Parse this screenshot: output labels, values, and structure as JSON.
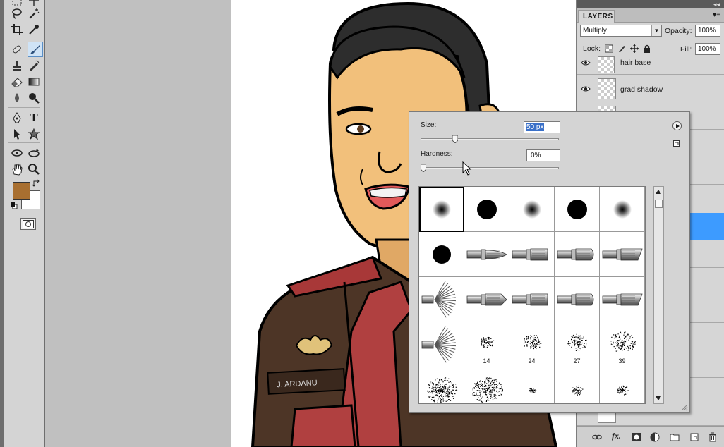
{
  "colors": {
    "foreground": "#a86f30",
    "background": "#ffffff",
    "selection": "#3d9bff",
    "skin": "#f2c07b",
    "hair": "#2d2d2d",
    "jacket": "#4d3526",
    "tie": "#b04040"
  },
  "toolbox": {
    "tools": [
      "lasso-icon",
      "magic-wand-icon",
      "crop-icon",
      "eyedropper-icon",
      "spot-healing-icon",
      "brush-icon",
      "clone-stamp-icon",
      "history-brush-icon",
      "eraser-icon",
      "gradient-icon",
      "blur-icon",
      "dodge-icon",
      "pen-icon",
      "type-icon",
      "path-selection-icon",
      "custom-shape-icon",
      "3d-rotate-icon",
      "3d-orbit-icon",
      "hand-icon",
      "zoom-icon"
    ],
    "type_glyph": "T"
  },
  "layers_panel": {
    "tab": "LAYERS",
    "menu_glyph": "▾≡",
    "collapse_glyph": "◂◂",
    "blend_mode": "Multiply",
    "opacity_label": "Opacity:",
    "opacity_value": "100%",
    "lock_label": "Lock:",
    "fill_label": "Fill:",
    "fill_value": "100%",
    "layers": [
      {
        "name": "hair base",
        "visible": true
      },
      {
        "name": "grad shadow",
        "visible": true
      }
    ],
    "footer_icons": [
      "link-layers-icon",
      "fx-icon",
      "layer-mask-icon",
      "adjustment-layer-icon",
      "group-folder-icon",
      "new-layer-icon",
      "trash-icon"
    ],
    "fx_text": "fx."
  },
  "brush_picker": {
    "size_label": "Size:",
    "size_value": "50 px",
    "hardness_label": "Hardness:",
    "hardness_value": "0%",
    "size_slider": 0.25,
    "hardness_slider": 0.0,
    "presets": [
      {
        "type": "soft-round"
      },
      {
        "type": "hard-round"
      },
      {
        "type": "soft-round"
      },
      {
        "type": "hard-round"
      },
      {
        "type": "soft-round"
      },
      {
        "type": "hard-round-small"
      },
      {
        "type": "round-bristle"
      },
      {
        "type": "flat-bristle"
      },
      {
        "type": "flat-blunt"
      },
      {
        "type": "angled-bristle"
      },
      {
        "type": "fan-bristle"
      },
      {
        "type": "point-bristle"
      },
      {
        "type": "flat-bristle"
      },
      {
        "type": "flat-blunt"
      },
      {
        "type": "angled-bristle"
      },
      {
        "type": "fan-bristle"
      },
      {
        "type": "spatter",
        "size": "14"
      },
      {
        "type": "spatter",
        "size": "24"
      },
      {
        "type": "spatter",
        "size": "27"
      },
      {
        "type": "spatter",
        "size": "39"
      },
      {
        "type": "spatter-large"
      },
      {
        "type": "spatter-large"
      },
      {
        "type": "spatter-small"
      },
      {
        "type": "spatter-medium"
      },
      {
        "type": "spatter-medium"
      }
    ]
  },
  "artwork": {
    "badge_text": "J. ARDANU"
  }
}
